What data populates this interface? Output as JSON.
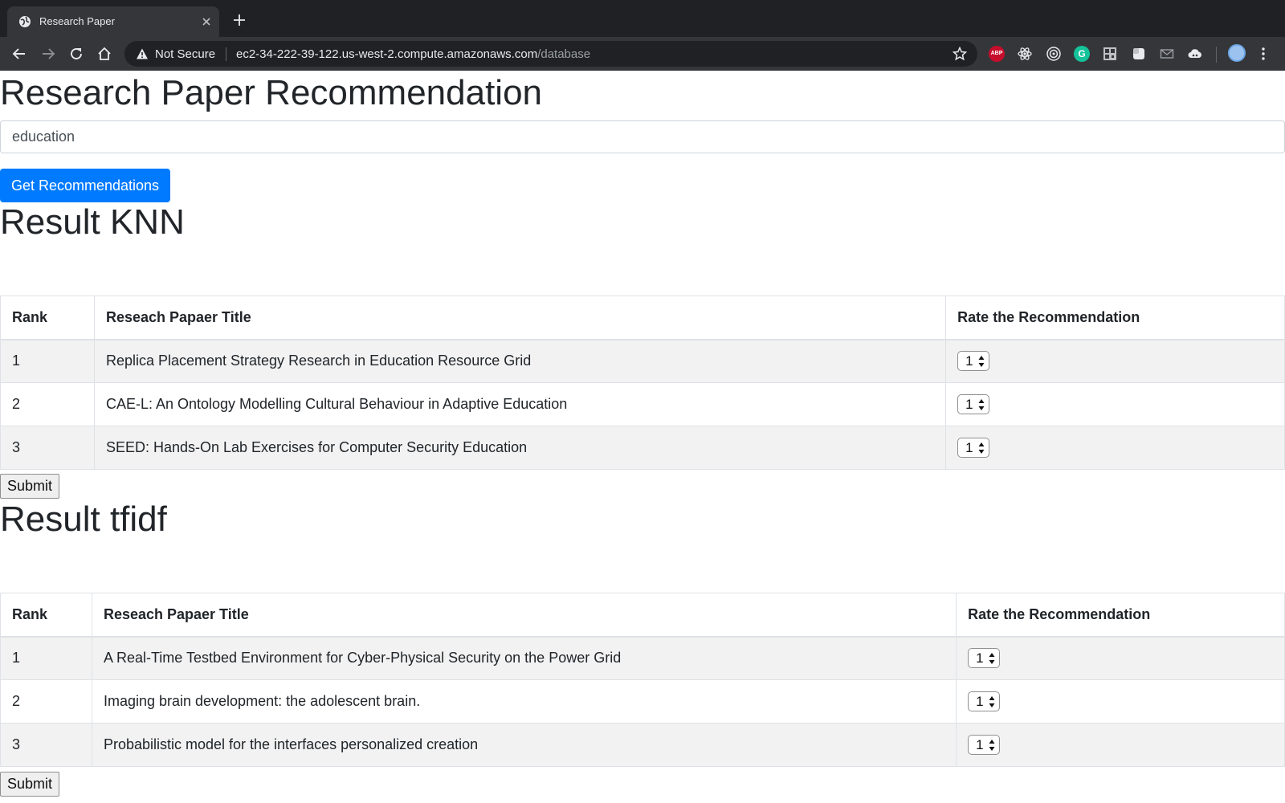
{
  "browser": {
    "tab_title": "Research Paper",
    "omnibox": {
      "security_label": "Not Secure",
      "url_host": "ec2-34-222-39-122.us-west-2.compute.amazonaws.com",
      "url_path": "/database"
    },
    "extensions": {
      "abp_label": "ABP",
      "grammarly_label": "G"
    }
  },
  "page": {
    "title": "Research Paper Recommendation",
    "search": {
      "value": "education"
    },
    "get_button_label": "Get Recommendations"
  },
  "sections": [
    {
      "title": "Result KNN",
      "headers": [
        "Rank",
        "Reseach Papaer Title",
        "Rate the Recommendation"
      ],
      "rows": [
        {
          "rank": "1",
          "title": "Replica Placement Strategy Research in Education Resource Grid",
          "rating": "1"
        },
        {
          "rank": "2",
          "title": "CAE-L: An Ontology Modelling Cultural Behaviour in Adaptive Education",
          "rating": "1"
        },
        {
          "rank": "3",
          "title": "SEED: Hands-On Lab Exercises for Computer Security Education",
          "rating": "1"
        }
      ],
      "submit_label": "Submit"
    },
    {
      "title": "Result tfidf",
      "headers": [
        "Rank",
        "Reseach Papaer Title",
        "Rate the Recommendation"
      ],
      "rows": [
        {
          "rank": "1",
          "title": "A Real-Time Testbed Environment for Cyber-Physical Security on the Power Grid",
          "rating": "1"
        },
        {
          "rank": "2",
          "title": "Imaging brain development: the adolescent brain.",
          "rating": "1"
        },
        {
          "rank": "3",
          "title": "Probabilistic model for the interfaces personalized creation",
          "rating": "1"
        }
      ],
      "submit_label": "Submit"
    }
  ],
  "colors": {
    "primary_button": "#007bff",
    "chrome_dark": "#202124",
    "chrome_toolbar": "#35363a",
    "table_stripe": "#f2f2f2"
  }
}
